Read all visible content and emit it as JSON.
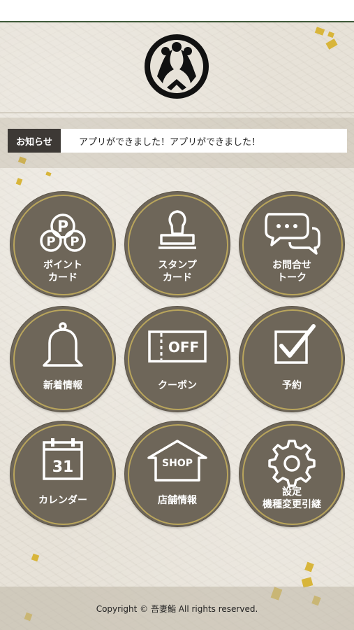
{
  "brand": {
    "logo_icon": "family-crest-logo-icon"
  },
  "notice": {
    "label": "お知らせ",
    "message": "アプリができました！アプリができました！"
  },
  "menu": [
    {
      "id": "point-card",
      "label": "ポイント\nカード",
      "icon": "point-card-icon"
    },
    {
      "id": "stamp-card",
      "label": "スタンプ\nカード",
      "icon": "stamp-icon"
    },
    {
      "id": "inquiry-talk",
      "label": "お問合せ\nトーク",
      "icon": "chat-bubbles-icon"
    },
    {
      "id": "news",
      "label": "新着情報",
      "icon": "bell-icon"
    },
    {
      "id": "coupon",
      "label": "クーポン",
      "icon": "coupon-icon",
      "icon_text": "OFF"
    },
    {
      "id": "reservation",
      "label": "予約",
      "icon": "checkbox-icon"
    },
    {
      "id": "calendar",
      "label": "カレンダー",
      "icon": "calendar-icon",
      "icon_text": "31"
    },
    {
      "id": "shop-info",
      "label": "店舗情報",
      "icon": "shop-icon",
      "icon_text": "SHOP"
    },
    {
      "id": "settings",
      "label": "設定\n機種変更引継",
      "icon": "gear-icon"
    }
  ],
  "footer": {
    "copyright": "Copyright © 吾妻鮨 All rights reserved."
  },
  "colors": {
    "tile": "#6e6659",
    "tile_ring": "#b9a55c",
    "notice_label_bg": "#3d3935",
    "accent_line": "#3f5a3a"
  }
}
